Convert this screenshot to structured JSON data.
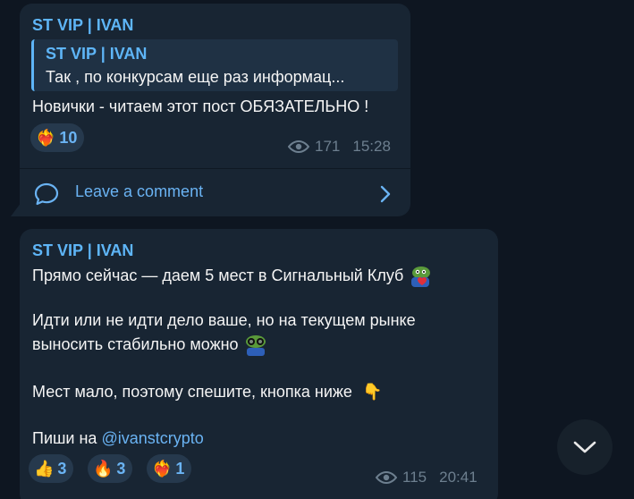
{
  "message1": {
    "author": "ST VIP | IVAN",
    "reply": {
      "author": "ST VIP | IVAN",
      "text": "Так , по конкурсам еще раз информац..."
    },
    "text": "Новички - читаем этот пост ОБЯЗАТЕЛЬНО !",
    "reactions": [
      {
        "emoji": "❤️‍🔥",
        "count": "10"
      }
    ],
    "views": "171",
    "time": "15:28",
    "comment_label": "Leave a comment"
  },
  "message2": {
    "author": "ST VIP | IVAN",
    "line1": "Прямо сейчас — даем 5 мест в Сигнальный Клуб",
    "line2": "Идти или не идти дело ваше, но на текущем рынке",
    "line3": "выносить стабильно можно",
    "line4": "Мест мало, поэтому спешите, кнопка ниже",
    "line4_emoji": "👇",
    "line5_prefix": "Пиши на",
    "mention": "@ivanstcrypto",
    "reactions": [
      {
        "emoji": "👍",
        "count": "3"
      },
      {
        "emoji": "🔥",
        "count": "3"
      },
      {
        "emoji": "❤️‍🔥",
        "count": "1"
      }
    ],
    "views": "115",
    "time": "20:41"
  },
  "colors": {
    "background": "#0e1621",
    "bubble": "#182533",
    "accent": "#5eb5f7",
    "link": "#6ab3f3",
    "meta": "#6d7f8f"
  },
  "icons": {
    "views": "eye-icon",
    "comment": "comment-bubble-icon",
    "chevron": "chevron-right-icon",
    "scroll_down": "chevron-down-icon"
  }
}
